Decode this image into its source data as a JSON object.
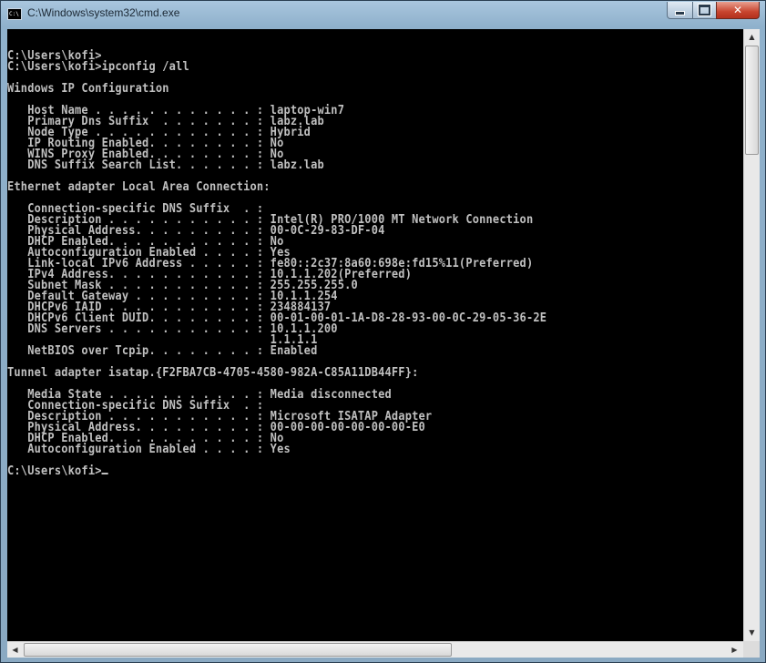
{
  "window": {
    "title": "C:\\Windows\\system32\\cmd.exe",
    "icon_label": "C:\\",
    "controls": {
      "minimize": "minimize",
      "maximize": "maximize",
      "close": "✕"
    }
  },
  "console": {
    "lines": [
      "",
      "C:\\Users\\kofi>",
      "C:\\Users\\kofi>ipconfig /all",
      "",
      "Windows IP Configuration",
      "",
      "   Host Name . . . . . . . . . . . . : laptop-win7",
      "   Primary Dns Suffix  . . . . . . . : labz.lab",
      "   Node Type . . . . . . . . . . . . : Hybrid",
      "   IP Routing Enabled. . . . . . . . : No",
      "   WINS Proxy Enabled. . . . . . . . : No",
      "   DNS Suffix Search List. . . . . . : labz.lab",
      "",
      "Ethernet adapter Local Area Connection:",
      "",
      "   Connection-specific DNS Suffix  . :",
      "   Description . . . . . . . . . . . : Intel(R) PRO/1000 MT Network Connection",
      "   Physical Address. . . . . . . . . : 00-0C-29-83-DF-04",
      "   DHCP Enabled. . . . . . . . . . . : No",
      "   Autoconfiguration Enabled . . . . : Yes",
      "   Link-local IPv6 Address . . . . . : fe80::2c37:8a60:698e:fd15%11(Preferred)",
      "   IPv4 Address. . . . . . . . . . . : 10.1.1.202(Preferred)",
      "   Subnet Mask . . . . . . . . . . . : 255.255.255.0",
      "   Default Gateway . . . . . . . . . : 10.1.1.254",
      "   DHCPv6 IAID . . . . . . . . . . . : 234884137",
      "   DHCPv6 Client DUID. . . . . . . . : 00-01-00-01-1A-D8-28-93-00-0C-29-05-36-2E",
      "   DNS Servers . . . . . . . . . . . : 10.1.1.200",
      "                                       1.1.1.1",
      "   NetBIOS over Tcpip. . . . . . . . : Enabled",
      "",
      "Tunnel adapter isatap.{F2FBA7CB-4705-4580-982A-C85A11DB44FF}:",
      "",
      "   Media State . . . . . . . . . . . : Media disconnected",
      "   Connection-specific DNS Suffix  . :",
      "   Description . . . . . . . . . . . : Microsoft ISATAP Adapter",
      "   Physical Address. . . . . . . . . : 00-00-00-00-00-00-00-E0",
      "   DHCP Enabled. . . . . . . . . . . : No",
      "   Autoconfiguration Enabled . . . . : Yes",
      ""
    ],
    "prompt": "C:\\Users\\kofi>"
  },
  "scrollbars": {
    "up_arrow": "▲",
    "down_arrow": "▼",
    "left_arrow": "◀",
    "right_arrow": "▶"
  },
  "colors": {
    "console_bg": "#000000",
    "console_fg": "#c0c0c0",
    "close_button": "#c8452f"
  }
}
